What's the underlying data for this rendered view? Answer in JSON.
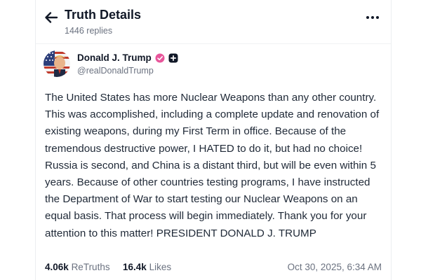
{
  "header": {
    "title": "Truth Details",
    "replies": "1446 replies",
    "back_icon": "arrow-left-icon",
    "more_icon": "more-horizontal-icon"
  },
  "author": {
    "display_name": "Donald J. Trump",
    "handle": "@realDonaldTrump",
    "verified_icon": "verified-check-icon",
    "badge_icon": "plus-badge-icon",
    "verified_color": "#e8569b"
  },
  "post": {
    "text": "The United States has more Nuclear Weapons than any other country. This was accomplished, including a complete update and renovation of existing weapons, during my First Term in office. Because of the tremendous destructive power, I HATED to do it, but had no choice! Russia is second, and China is a distant third, but will be even within 5 years. Because of other countries testing programs, I have instructed the Department of War to start testing our Nuclear Weapons on an equal basis. That process will begin immediately. Thank you for your attention to this matter! PRESIDENT DONALD J. TRUMP"
  },
  "stats": {
    "retruths_count": "4.06k",
    "retruths_label": "ReTruths",
    "likes_count": "16.4k",
    "likes_label": "Likes"
  },
  "timestamp": "Oct 30, 2025, 6:34 AM"
}
